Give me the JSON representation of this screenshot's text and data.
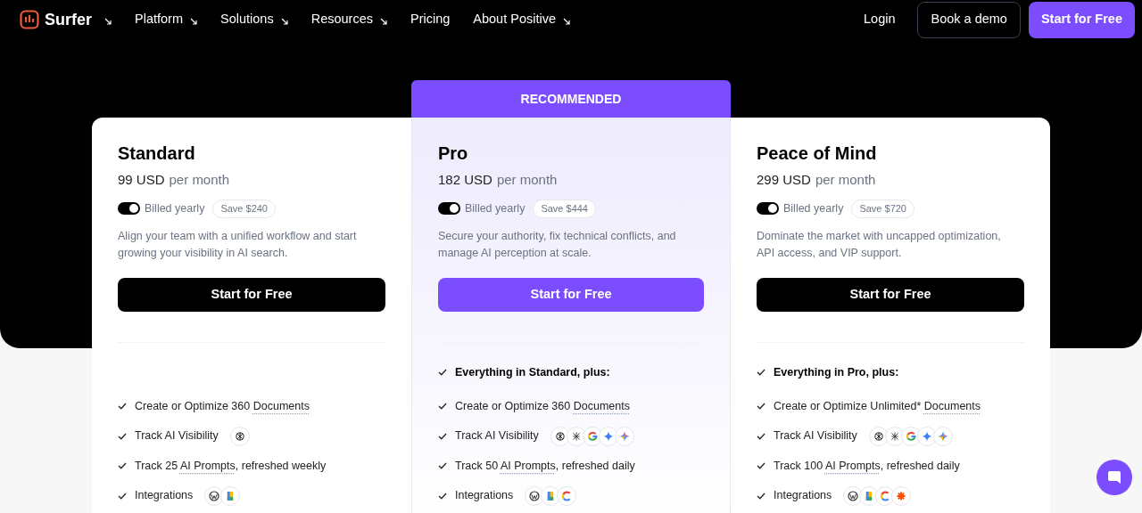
{
  "nav": {
    "brand": "Surfer",
    "brand_menu": true,
    "items": [
      {
        "label": "Platform",
        "has_menu": true
      },
      {
        "label": "Solutions",
        "has_menu": true
      },
      {
        "label": "Resources",
        "has_menu": true
      },
      {
        "label": "Pricing",
        "has_menu": false
      },
      {
        "label": "About Positive",
        "has_menu": true
      }
    ],
    "actions": [
      {
        "label": "Login",
        "kind": "link"
      },
      {
        "label": "Book a demo",
        "kind": "outline"
      },
      {
        "label": "Start for Free",
        "kind": "primary"
      }
    ]
  },
  "plans": [
    {
      "name": "Standard",
      "recommended": false,
      "price": "99 USD",
      "period": "per month",
      "billed_yearly": true,
      "billing_label": "Billed yearly",
      "save": "Save $240",
      "description": "Align your team with a unified workflow and start growing your visibility in AI search.",
      "cta": "Start for Free",
      "features": [
        {
          "before": "Create or Optimize 360 ",
          "term": "Documents"
        },
        {
          "before": "Track AI Visibility",
          "icons": [
            {
              "kind": "swirl"
            }
          ]
        },
        {
          "before": "Track 25 ",
          "term": "AI Prompts",
          "after": ", refreshed weekly"
        },
        {
          "before": "Integrations",
          "icons": [
            {
              "kind": "w"
            },
            {
              "kind": "doc"
            }
          ]
        }
      ]
    },
    {
      "name": "Pro",
      "recommended": true,
      "ribbon": "RECOMMENDED",
      "price": "182 USD",
      "period": "per month",
      "billed_yearly": true,
      "billing_label": "Billed yearly",
      "save": "Save $444",
      "description": "Secure your authority, fix technical conflicts, and manage AI perception at scale.",
      "cta": "Start for Free",
      "heading": "Everything in Standard, plus:",
      "features": [
        {
          "before": "Create or Optimize 360 ",
          "term": "Documents"
        },
        {
          "before": "Track AI Visibility",
          "icons": [
            {
              "kind": "swirl"
            },
            {
              "kind": "knot"
            },
            {
              "kind": "g"
            },
            {
              "kind": "sparkle"
            },
            {
              "kind": "sparkle-multi"
            }
          ]
        },
        {
          "before": "Track 50 ",
          "term": "AI Prompts",
          "after": ", refreshed daily"
        },
        {
          "before": "Integrations",
          "icons": [
            {
              "kind": "w"
            },
            {
              "kind": "doc"
            },
            {
              "kind": "c"
            }
          ]
        }
      ]
    },
    {
      "name": "Peace of Mind",
      "recommended": false,
      "price": "299 USD",
      "period": "per month",
      "billed_yearly": true,
      "billing_label": "Billed yearly",
      "save": "Save $720",
      "description": "Dominate the market with uncapped optimization, API access, and VIP support.",
      "cta": "Start for Free",
      "heading": "Everything in Pro, plus:",
      "features": [
        {
          "before": "Create or Optimize Unlimited* ",
          "term": "Documents"
        },
        {
          "before": "Track AI Visibility",
          "icons": [
            {
              "kind": "swirl"
            },
            {
              "kind": "knot"
            },
            {
              "kind": "g"
            },
            {
              "kind": "sparkle"
            },
            {
              "kind": "sparkle-multi"
            }
          ]
        },
        {
          "before": "Track 100 ",
          "term": "AI Prompts",
          "after": ", refreshed daily"
        },
        {
          "before": "Integrations",
          "icons": [
            {
              "kind": "w"
            },
            {
              "kind": "doc"
            },
            {
              "kind": "c"
            },
            {
              "kind": "asterisk"
            }
          ]
        }
      ]
    }
  ]
}
